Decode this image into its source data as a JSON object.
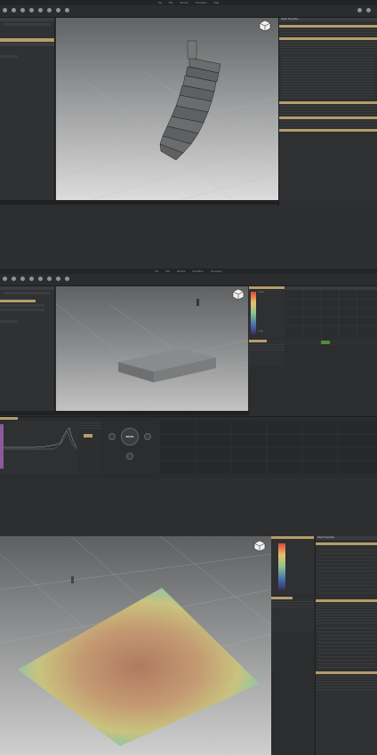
{
  "app": {
    "menu": [
      "File",
      "Edit",
      "Window",
      "Simulation",
      "Help"
    ],
    "menu2": [
      "File",
      "Edit",
      "Window",
      "Simulation",
      "Processing"
    ],
    "tools": [
      "",
      "",
      "",
      "",
      "",
      "",
      "",
      "",
      "",
      "",
      "",
      ""
    ]
  },
  "panel1": {
    "properties_title": "Object Properties",
    "header_items": [
      "Line Array",
      "Speaker",
      "Position"
    ]
  },
  "panel2": {
    "scale_top": "105 dB",
    "scale_bottom": "70 dB",
    "eq_title": "Properties",
    "bass_label": "BASS"
  },
  "panel3": {
    "properties_title": "Object Properties"
  },
  "colors": {
    "accent_gold": "#b59d6a",
    "bg": "#2b2d2f",
    "panel": "#2f3133"
  }
}
